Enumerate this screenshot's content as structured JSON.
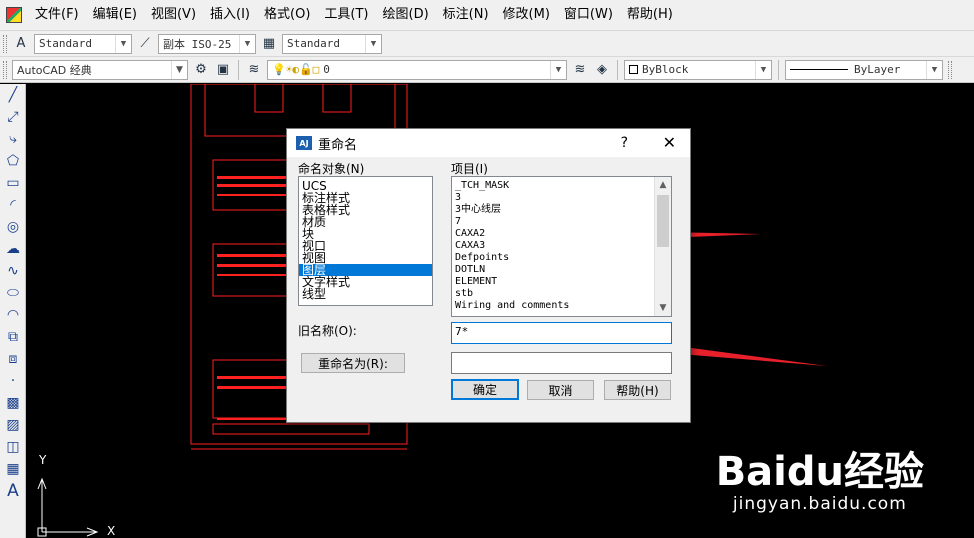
{
  "menu": {
    "items": [
      "文件(F)",
      "编辑(E)",
      "视图(V)",
      "插入(I)",
      "格式(O)",
      "工具(T)",
      "绘图(D)",
      "标注(N)",
      "修改(M)",
      "窗口(W)",
      "帮助(H)"
    ]
  },
  "toolbar1": {
    "text_style": "Standard",
    "dim_style": "副本 ISO-25",
    "table_style": "Standard"
  },
  "toolbar2": {
    "workspace": "AutoCAD 经典",
    "layer": "0",
    "color": "ByBlock",
    "linetype": "ByLayer"
  },
  "canvas": {
    "axis_y": "Y",
    "axis_x": "X"
  },
  "dialog": {
    "title": "重命名",
    "help_glyph": "?",
    "close_glyph": "✕",
    "named_objects_label": "命名对象(N)",
    "named_objects": [
      "UCS",
      "标注样式",
      "表格样式",
      "材质",
      "块",
      "视口",
      "视图",
      "图层",
      "文字样式",
      "线型"
    ],
    "selected_object": "图层",
    "items_label": "项目(I)",
    "items": [
      "_TCH_MASK",
      "3",
      "3中心线层",
      "7",
      "CAXA2",
      "CAXA3",
      "Defpoints",
      "DOTLN",
      "ELEMENT",
      "stb",
      "Wiring and comments"
    ],
    "old_name_label": "旧名称(O):",
    "old_name_value": "7*",
    "rename_to_button": "重命名为(R):",
    "rename_to_value": "",
    "ok_button": "确定",
    "cancel_button": "取消",
    "help_button": "帮助(H)"
  },
  "watermark": {
    "logo": "Baidu经验",
    "url": "jingyan.baidu.com"
  },
  "colors": {
    "canvas_bg": "#000000",
    "drawing_line": "#ff2020",
    "annotation": "#e8202a",
    "selection": "#0078d7"
  }
}
